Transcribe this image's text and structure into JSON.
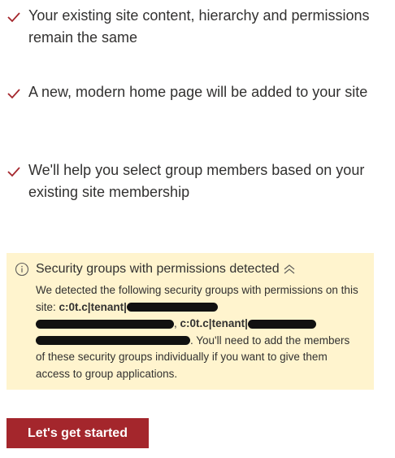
{
  "checklist": {
    "items": [
      {
        "icon": "checkmark-icon",
        "text": "Your existing site content, hierarchy and permissions remain the same"
      },
      {
        "icon": "checkmark-icon",
        "text": "A new, modern home page will be added to your site"
      },
      {
        "icon": "checkmark-icon",
        "text": "We'll help you select group members based on your existing site membership"
      }
    ]
  },
  "warning": {
    "icon": "info-icon",
    "title": "Security groups with permissions detected",
    "collapse_icon": "chevron-double-up-icon",
    "body_intro": "We detected the following security groups with permissions on this site:",
    "group_1": "c:0t.c|tenant|",
    "separator": ",",
    "group_2": "c:0t.c|tenant|",
    "body_outro": ". You'll need to add the members of these security groups individually if you want to give them access to group applications."
  },
  "actions": {
    "primary_label": "Let's get started"
  },
  "colors": {
    "accent": "#a4262c",
    "warning_background": "#fff4ce",
    "text": "#323130"
  }
}
